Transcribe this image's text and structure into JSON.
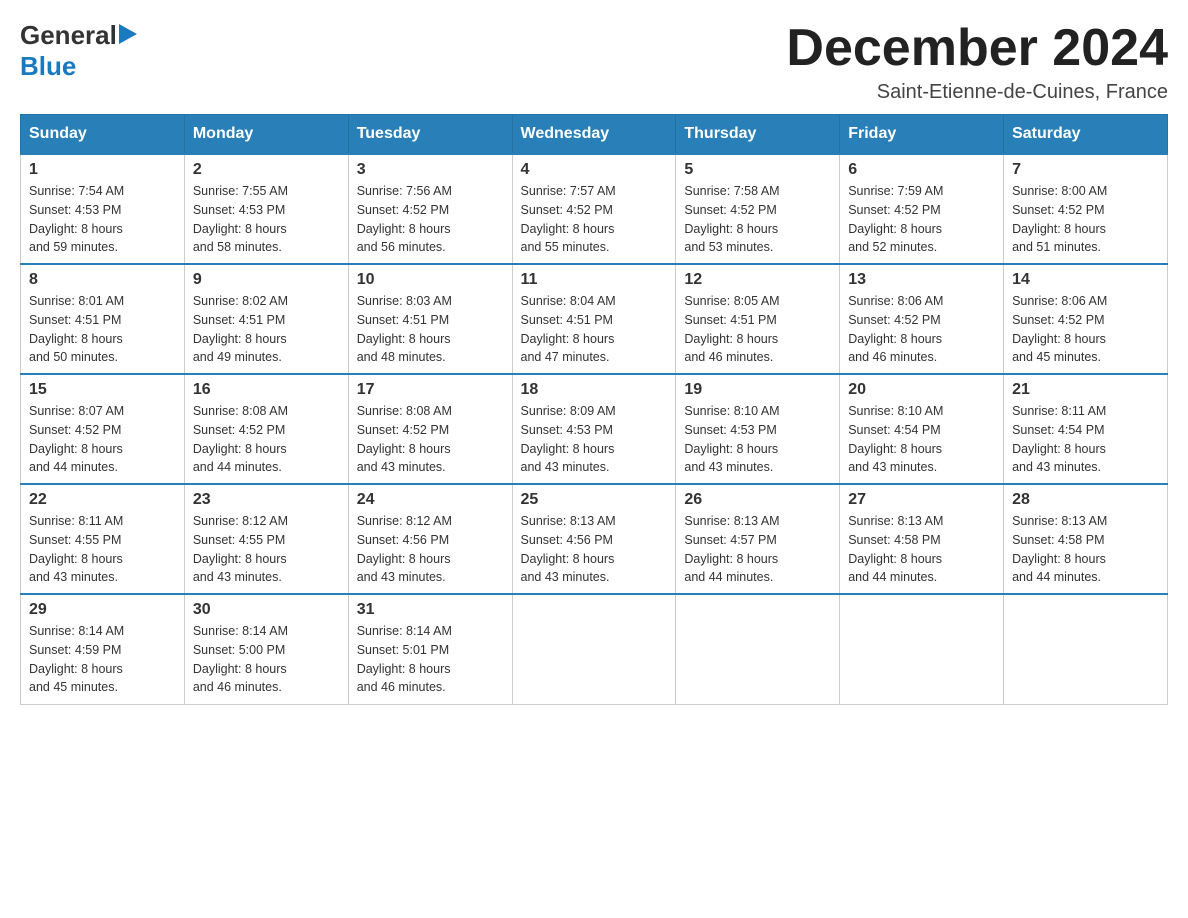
{
  "logo": {
    "general": "General",
    "blue": "Blue"
  },
  "title": "December 2024",
  "location": "Saint-Etienne-de-Cuines, France",
  "weekdays": [
    "Sunday",
    "Monday",
    "Tuesday",
    "Wednesday",
    "Thursday",
    "Friday",
    "Saturday"
  ],
  "weeks": [
    [
      {
        "day": "1",
        "sunrise": "7:54 AM",
        "sunset": "4:53 PM",
        "daylight": "8 hours",
        "minutes": "and 59 minutes."
      },
      {
        "day": "2",
        "sunrise": "7:55 AM",
        "sunset": "4:53 PM",
        "daylight": "8 hours",
        "minutes": "and 58 minutes."
      },
      {
        "day": "3",
        "sunrise": "7:56 AM",
        "sunset": "4:52 PM",
        "daylight": "8 hours",
        "minutes": "and 56 minutes."
      },
      {
        "day": "4",
        "sunrise": "7:57 AM",
        "sunset": "4:52 PM",
        "daylight": "8 hours",
        "minutes": "and 55 minutes."
      },
      {
        "day": "5",
        "sunrise": "7:58 AM",
        "sunset": "4:52 PM",
        "daylight": "8 hours",
        "minutes": "and 53 minutes."
      },
      {
        "day": "6",
        "sunrise": "7:59 AM",
        "sunset": "4:52 PM",
        "daylight": "8 hours",
        "minutes": "and 52 minutes."
      },
      {
        "day": "7",
        "sunrise": "8:00 AM",
        "sunset": "4:52 PM",
        "daylight": "8 hours",
        "minutes": "and 51 minutes."
      }
    ],
    [
      {
        "day": "8",
        "sunrise": "8:01 AM",
        "sunset": "4:51 PM",
        "daylight": "8 hours",
        "minutes": "and 50 minutes."
      },
      {
        "day": "9",
        "sunrise": "8:02 AM",
        "sunset": "4:51 PM",
        "daylight": "8 hours",
        "minutes": "and 49 minutes."
      },
      {
        "day": "10",
        "sunrise": "8:03 AM",
        "sunset": "4:51 PM",
        "daylight": "8 hours",
        "minutes": "and 48 minutes."
      },
      {
        "day": "11",
        "sunrise": "8:04 AM",
        "sunset": "4:51 PM",
        "daylight": "8 hours",
        "minutes": "and 47 minutes."
      },
      {
        "day": "12",
        "sunrise": "8:05 AM",
        "sunset": "4:51 PM",
        "daylight": "8 hours",
        "minutes": "and 46 minutes."
      },
      {
        "day": "13",
        "sunrise": "8:06 AM",
        "sunset": "4:52 PM",
        "daylight": "8 hours",
        "minutes": "and 46 minutes."
      },
      {
        "day": "14",
        "sunrise": "8:06 AM",
        "sunset": "4:52 PM",
        "daylight": "8 hours",
        "minutes": "and 45 minutes."
      }
    ],
    [
      {
        "day": "15",
        "sunrise": "8:07 AM",
        "sunset": "4:52 PM",
        "daylight": "8 hours",
        "minutes": "and 44 minutes."
      },
      {
        "day": "16",
        "sunrise": "8:08 AM",
        "sunset": "4:52 PM",
        "daylight": "8 hours",
        "minutes": "and 44 minutes."
      },
      {
        "day": "17",
        "sunrise": "8:08 AM",
        "sunset": "4:52 PM",
        "daylight": "8 hours",
        "minutes": "and 43 minutes."
      },
      {
        "day": "18",
        "sunrise": "8:09 AM",
        "sunset": "4:53 PM",
        "daylight": "8 hours",
        "minutes": "and 43 minutes."
      },
      {
        "day": "19",
        "sunrise": "8:10 AM",
        "sunset": "4:53 PM",
        "daylight": "8 hours",
        "minutes": "and 43 minutes."
      },
      {
        "day": "20",
        "sunrise": "8:10 AM",
        "sunset": "4:54 PM",
        "daylight": "8 hours",
        "minutes": "and 43 minutes."
      },
      {
        "day": "21",
        "sunrise": "8:11 AM",
        "sunset": "4:54 PM",
        "daylight": "8 hours",
        "minutes": "and 43 minutes."
      }
    ],
    [
      {
        "day": "22",
        "sunrise": "8:11 AM",
        "sunset": "4:55 PM",
        "daylight": "8 hours",
        "minutes": "and 43 minutes."
      },
      {
        "day": "23",
        "sunrise": "8:12 AM",
        "sunset": "4:55 PM",
        "daylight": "8 hours",
        "minutes": "and 43 minutes."
      },
      {
        "day": "24",
        "sunrise": "8:12 AM",
        "sunset": "4:56 PM",
        "daylight": "8 hours",
        "minutes": "and 43 minutes."
      },
      {
        "day": "25",
        "sunrise": "8:13 AM",
        "sunset": "4:56 PM",
        "daylight": "8 hours",
        "minutes": "and 43 minutes."
      },
      {
        "day": "26",
        "sunrise": "8:13 AM",
        "sunset": "4:57 PM",
        "daylight": "8 hours",
        "minutes": "and 44 minutes."
      },
      {
        "day": "27",
        "sunrise": "8:13 AM",
        "sunset": "4:58 PM",
        "daylight": "8 hours",
        "minutes": "and 44 minutes."
      },
      {
        "day": "28",
        "sunrise": "8:13 AM",
        "sunset": "4:58 PM",
        "daylight": "8 hours",
        "minutes": "and 44 minutes."
      }
    ],
    [
      {
        "day": "29",
        "sunrise": "8:14 AM",
        "sunset": "4:59 PM",
        "daylight": "8 hours",
        "minutes": "and 45 minutes."
      },
      {
        "day": "30",
        "sunrise": "8:14 AM",
        "sunset": "5:00 PM",
        "daylight": "8 hours",
        "minutes": "and 46 minutes."
      },
      {
        "day": "31",
        "sunrise": "8:14 AM",
        "sunset": "5:01 PM",
        "daylight": "8 hours",
        "minutes": "and 46 minutes."
      },
      null,
      null,
      null,
      null
    ]
  ],
  "labels": {
    "sunrise": "Sunrise:",
    "sunset": "Sunset:",
    "daylight": "Daylight:"
  }
}
